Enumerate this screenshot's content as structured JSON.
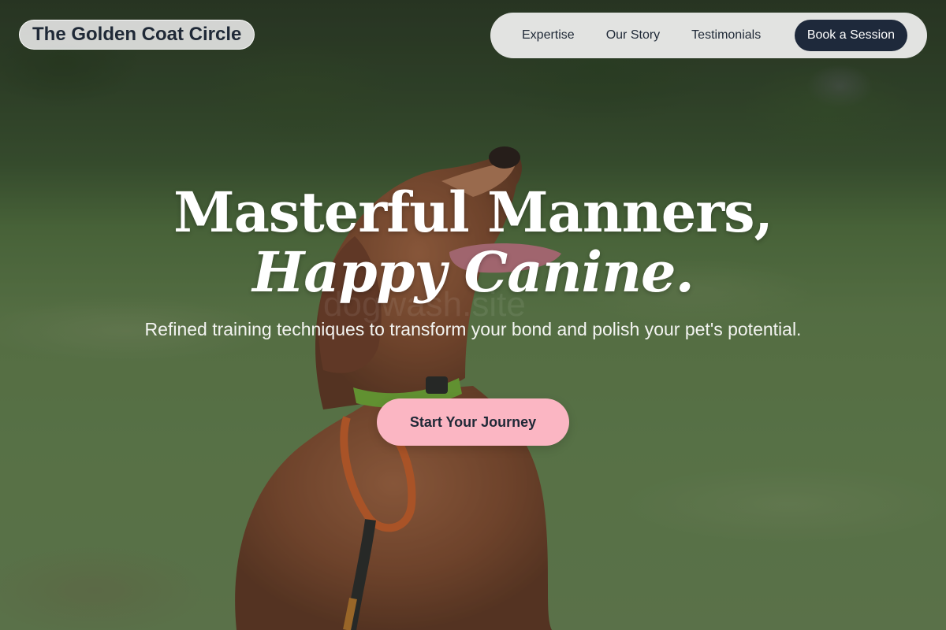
{
  "brand": {
    "name": "The Golden Coat Circle"
  },
  "nav": {
    "links": [
      "Expertise",
      "Our Story",
      "Testimonials"
    ],
    "cta_label": "Book a Session"
  },
  "hero": {
    "headline_line1": "Masterful Manners,",
    "headline_line2": "Happy Canine.",
    "subtitle": "Refined training techniques to transform your bond and polish your pet's potential.",
    "cta_label": "Start Your Journey",
    "watermark": "dogwash.site",
    "background_image": "dog-photo",
    "colors": {
      "accent_pink": "#fbb6c3",
      "nav_dark": "#1e293b"
    }
  }
}
